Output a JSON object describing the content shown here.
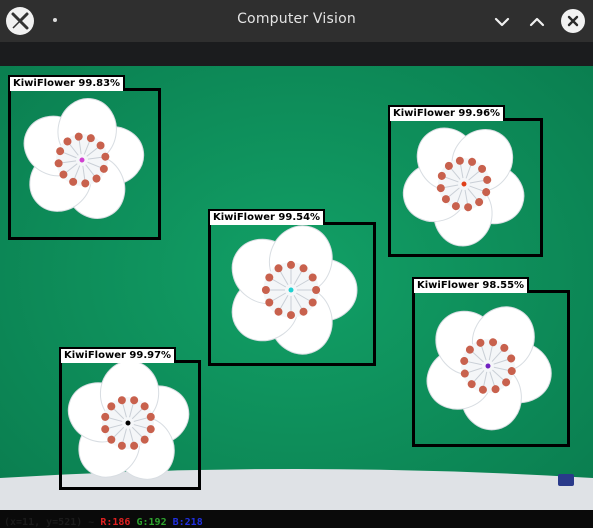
{
  "window": {
    "title": "Computer Vision",
    "app_icon": "x-logo-icon",
    "controls": {
      "minimize_icon": "chevron-down-icon",
      "maximize_icon": "chevron-up-icon",
      "close_icon": "close-icon"
    }
  },
  "colors": {
    "felt": "#0f8f5c",
    "box": "#000000",
    "petal": "#ffffff",
    "stamen": "#c8614d",
    "label_bg": "#ffffff"
  },
  "detections": [
    {
      "label": "KiwiFlower 99.83%",
      "center_color": "#d040d0"
    },
    {
      "label": "KiwiFlower 99.96%",
      "center_color": "#e0401a"
    },
    {
      "label": "KiwiFlower 99.54%",
      "center_color": "#20d0d0"
    },
    {
      "label": "KiwiFlower 98.55%",
      "center_color": "#7020c0"
    },
    {
      "label": "KiwiFlower 99.97%",
      "center_color": "#000000"
    }
  ],
  "status": {
    "xy": "(x=11, y=521) ~",
    "r": "R:186",
    "g": "G:192",
    "b": "B:218"
  }
}
